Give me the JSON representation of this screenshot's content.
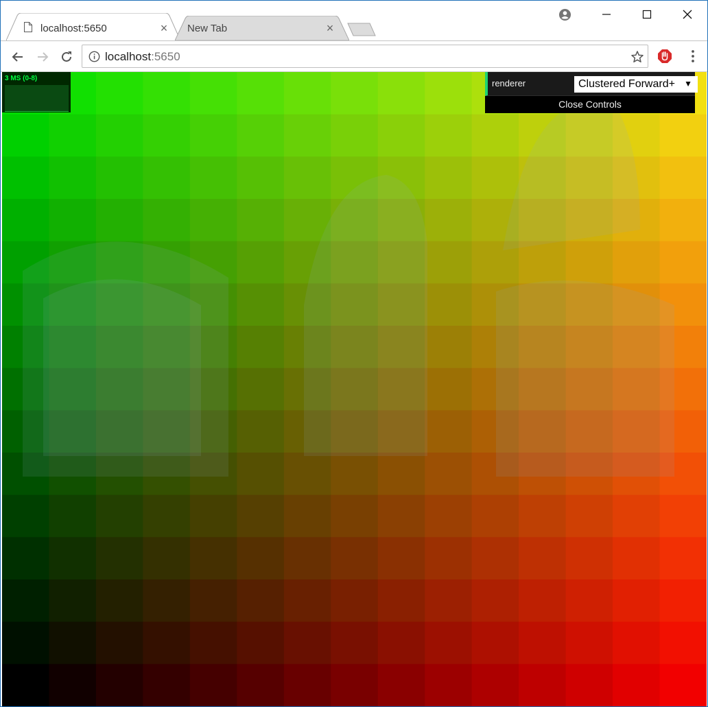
{
  "browser": {
    "tabs": [
      {
        "label": "localhost:5650",
        "active": true
      },
      {
        "label": "New Tab",
        "active": false
      }
    ],
    "close_glyph": "×",
    "url_host": "localhost",
    "url_port": ":5650",
    "icons": [
      "page-icon",
      "tab-close-icon",
      "new-tab-icon",
      "account-icon",
      "minimize-icon",
      "maximize-icon",
      "close-icon",
      "back-icon",
      "forward-icon",
      "reload-icon",
      "info-icon",
      "star-icon",
      "extension-icon",
      "menu-icon"
    ]
  },
  "stats": {
    "label": "3 MS (0-8)"
  },
  "controls": {
    "renderer_label": "renderer",
    "renderer_value": "Clustered Forward+",
    "renderer_arrow": "▼",
    "close_label": "Close Controls"
  },
  "scene": {
    "columns": 15,
    "rows": 15,
    "description_colors": {
      "top_left": "#00e000",
      "top_right": "#f2e011",
      "bottom_left": "#000000",
      "bottom_right": "#f20000"
    }
  }
}
